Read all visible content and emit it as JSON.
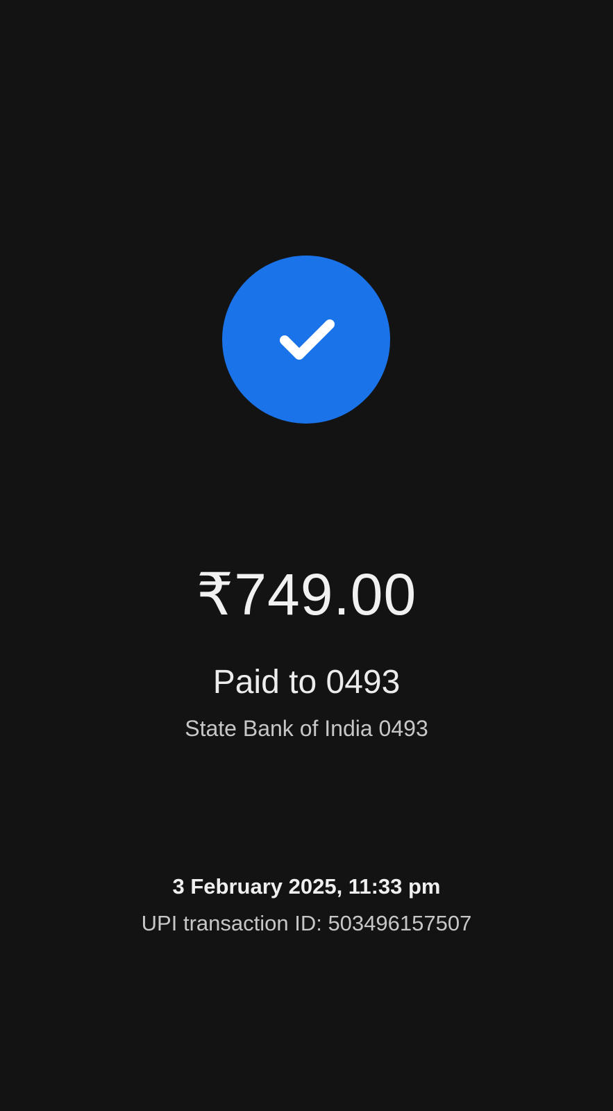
{
  "status": {
    "icon": "check-icon",
    "badge_color": "#1a73e8"
  },
  "payment": {
    "amount": "₹749.00",
    "paid_to": "Paid to 0493",
    "bank": "State Bank of India 0493",
    "datetime": "3 February 2025, 11:33 pm",
    "transaction_id": "UPI transaction ID: 503496157507"
  }
}
